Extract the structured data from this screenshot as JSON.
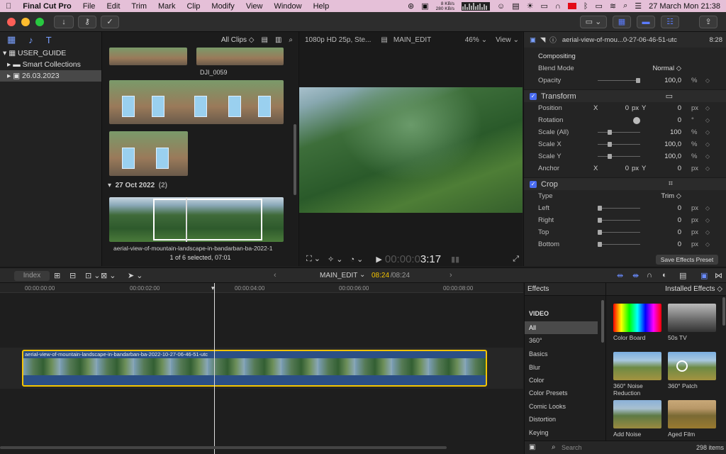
{
  "menubar": {
    "app": "Final Cut Pro",
    "items": [
      "File",
      "Edit",
      "Trim",
      "Mark",
      "Clip",
      "Modify",
      "View",
      "Window",
      "Help"
    ],
    "net_up": "8 KB/s",
    "net_down": "280 KB/s",
    "clock": "27 March Mon  21:38"
  },
  "library": {
    "name": "USER_GUIDE",
    "smart": "Smart Collections",
    "event": "26.03.2023"
  },
  "browser": {
    "filter": "All Clips ◇",
    "clip_name_1": "DJI_0059",
    "date_group": "27 Oct 2022",
    "date_count": "(2)",
    "clip_name_2": "aerial-view-of-mountain-landscape-in-bandarban-ba-2022-1",
    "status": "1 of 6 selected, 07:01"
  },
  "viewer": {
    "format": "1080p HD 25p, Ste...",
    "project": "MAIN_EDIT",
    "zoom": "46%",
    "view": "View",
    "timecode_dim": "00:00:0",
    "timecode_bright": "3:17"
  },
  "inspector": {
    "clip_title": "aerial-view-of-mou...0-27-06-46-51-utc",
    "duration": "8:28",
    "compositing": "Compositing",
    "blend_label": "Blend Mode",
    "blend_value": "Normal ◇",
    "opacity_label": "Opacity",
    "opacity_value": "100,0",
    "pct": "%",
    "transform": "Transform",
    "position_label": "Position",
    "x": "X",
    "y": "Y",
    "px": "px",
    "pos_x": "0",
    "pos_y": "0",
    "rotation_label": "Rotation",
    "rotation_value": "0",
    "deg": "°",
    "scale_all_label": "Scale (All)",
    "scale_all_value": "100",
    "scale_x_label": "Scale X",
    "scale_x_value": "100,0",
    "scale_y_label": "Scale Y",
    "scale_y_value": "100,0",
    "anchor_label": "Anchor",
    "anchor_x": "0",
    "anchor_y": "0",
    "crop": "Crop",
    "type_label": "Type",
    "type_value": "Trim ◇",
    "left_label": "Left",
    "left_value": "0",
    "right_label": "Right",
    "right_value": "0",
    "top_label": "Top",
    "top_value": "0",
    "bottom_label": "Bottom",
    "bottom_value": "0",
    "save_preset": "Save Effects Preset"
  },
  "timeline": {
    "index": "Index",
    "project": "MAIN_EDIT",
    "time_current": "08:24",
    "time_sep": " / ",
    "time_total": "08:24",
    "ticks": [
      "00:00:00:00",
      "00:00:02:00",
      "00:00:04:00",
      "00:00:06:00",
      "00:00:08:00"
    ],
    "clip_label": "aerial-view-of-mountain-landscape-in-bandarban-ba-2022-10-27-06-46-51-utc"
  },
  "effects": {
    "title": "Effects",
    "installed": "Installed Effects ◇",
    "section": "VIDEO",
    "categories": [
      "All",
      "360°",
      "Basics",
      "Blur",
      "Color",
      "Color Presets",
      "Comic Looks",
      "Distortion",
      "Keying"
    ],
    "tiles": [
      "Color Board",
      "50s TV",
      "360° Noise Reduction",
      "360° Patch",
      "Add Noise",
      "Aged Film"
    ],
    "search": "Search",
    "count": "298 items"
  }
}
